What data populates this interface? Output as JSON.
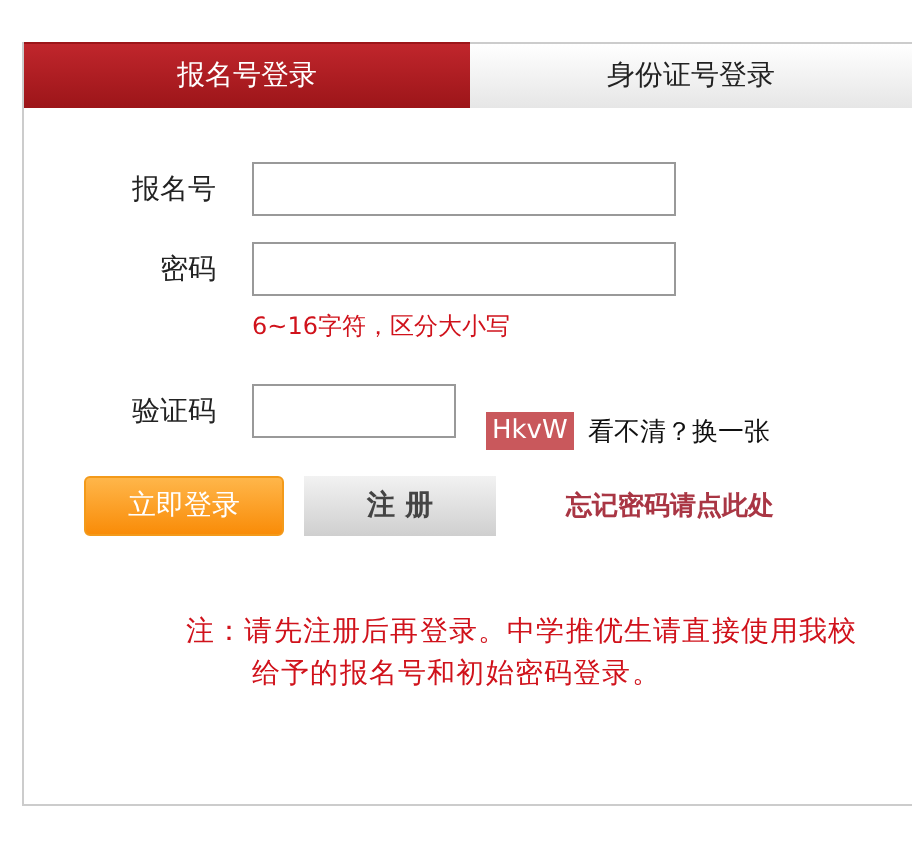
{
  "tabs": [
    {
      "label": "报名号登录",
      "selected": true
    },
    {
      "label": "身份证号登录",
      "selected": false
    }
  ],
  "form": {
    "fields": [
      {
        "label": "报名号",
        "kind": "text"
      },
      {
        "label": "密码",
        "kind": "password",
        "hint": "6~16字符，区分大小写"
      },
      {
        "label": "验证码",
        "kind": "captcha",
        "captcha": "HkvW",
        "refresh": "看不清？换一张"
      }
    ],
    "login_button": "立即登录",
    "register_button": "注 册",
    "forgot_link": "忘记密码请点此处"
  },
  "note": "注：请先注册后再登录。中学推优生请直接使用我校给予的报名号和初始密码登录。"
}
